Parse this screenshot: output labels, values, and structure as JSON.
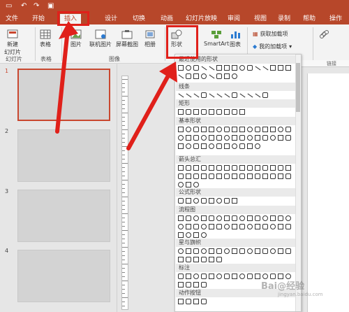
{
  "titlebar": {
    "icons": [
      "save-icon",
      "undo-icon",
      "redo-icon",
      "present-icon"
    ]
  },
  "menu_tabs": [
    {
      "label": "文件"
    },
    {
      "label": "开始"
    },
    {
      "label": "插入"
    },
    {
      "label": "设计"
    },
    {
      "label": "切换"
    },
    {
      "label": "动画"
    },
    {
      "label": "幻灯片放映"
    },
    {
      "label": "审阅"
    },
    {
      "label": "视图"
    },
    {
      "label": "录制"
    },
    {
      "label": "帮助"
    },
    {
      "label": "操作"
    }
  ],
  "ribbon": {
    "new_slide": "新建\n幻灯片",
    "table": "表格",
    "picture": "图片",
    "online_picture": "联机图片",
    "screenshot": "屏幕截图",
    "album": "相册",
    "shapes": "形状",
    "smartart": "SmartArt",
    "chart": "图表",
    "get_addins": "获取加载项",
    "my_addins": "我的加载项",
    "groups": {
      "slides": "幻灯片",
      "tables": "表格",
      "images": "图像"
    }
  },
  "slides": [
    {
      "number": "1"
    },
    {
      "number": "2"
    },
    {
      "number": "3"
    },
    {
      "number": "4"
    }
  ],
  "shapes_panel": {
    "categories": [
      "最近使用的形状",
      "线条",
      "矩形",
      "基本形状",
      "箭头总汇",
      "公式形状",
      "流程图",
      "星与旗帜",
      "标注",
      "动作按钮"
    ]
  },
  "ruler_label": "链接",
  "watermark": {
    "line1": "Bai@经验",
    "line2": "jingyan.baidu.com"
  },
  "colors": {
    "accent": "#b7472a",
    "highlight": "#e0201a"
  }
}
